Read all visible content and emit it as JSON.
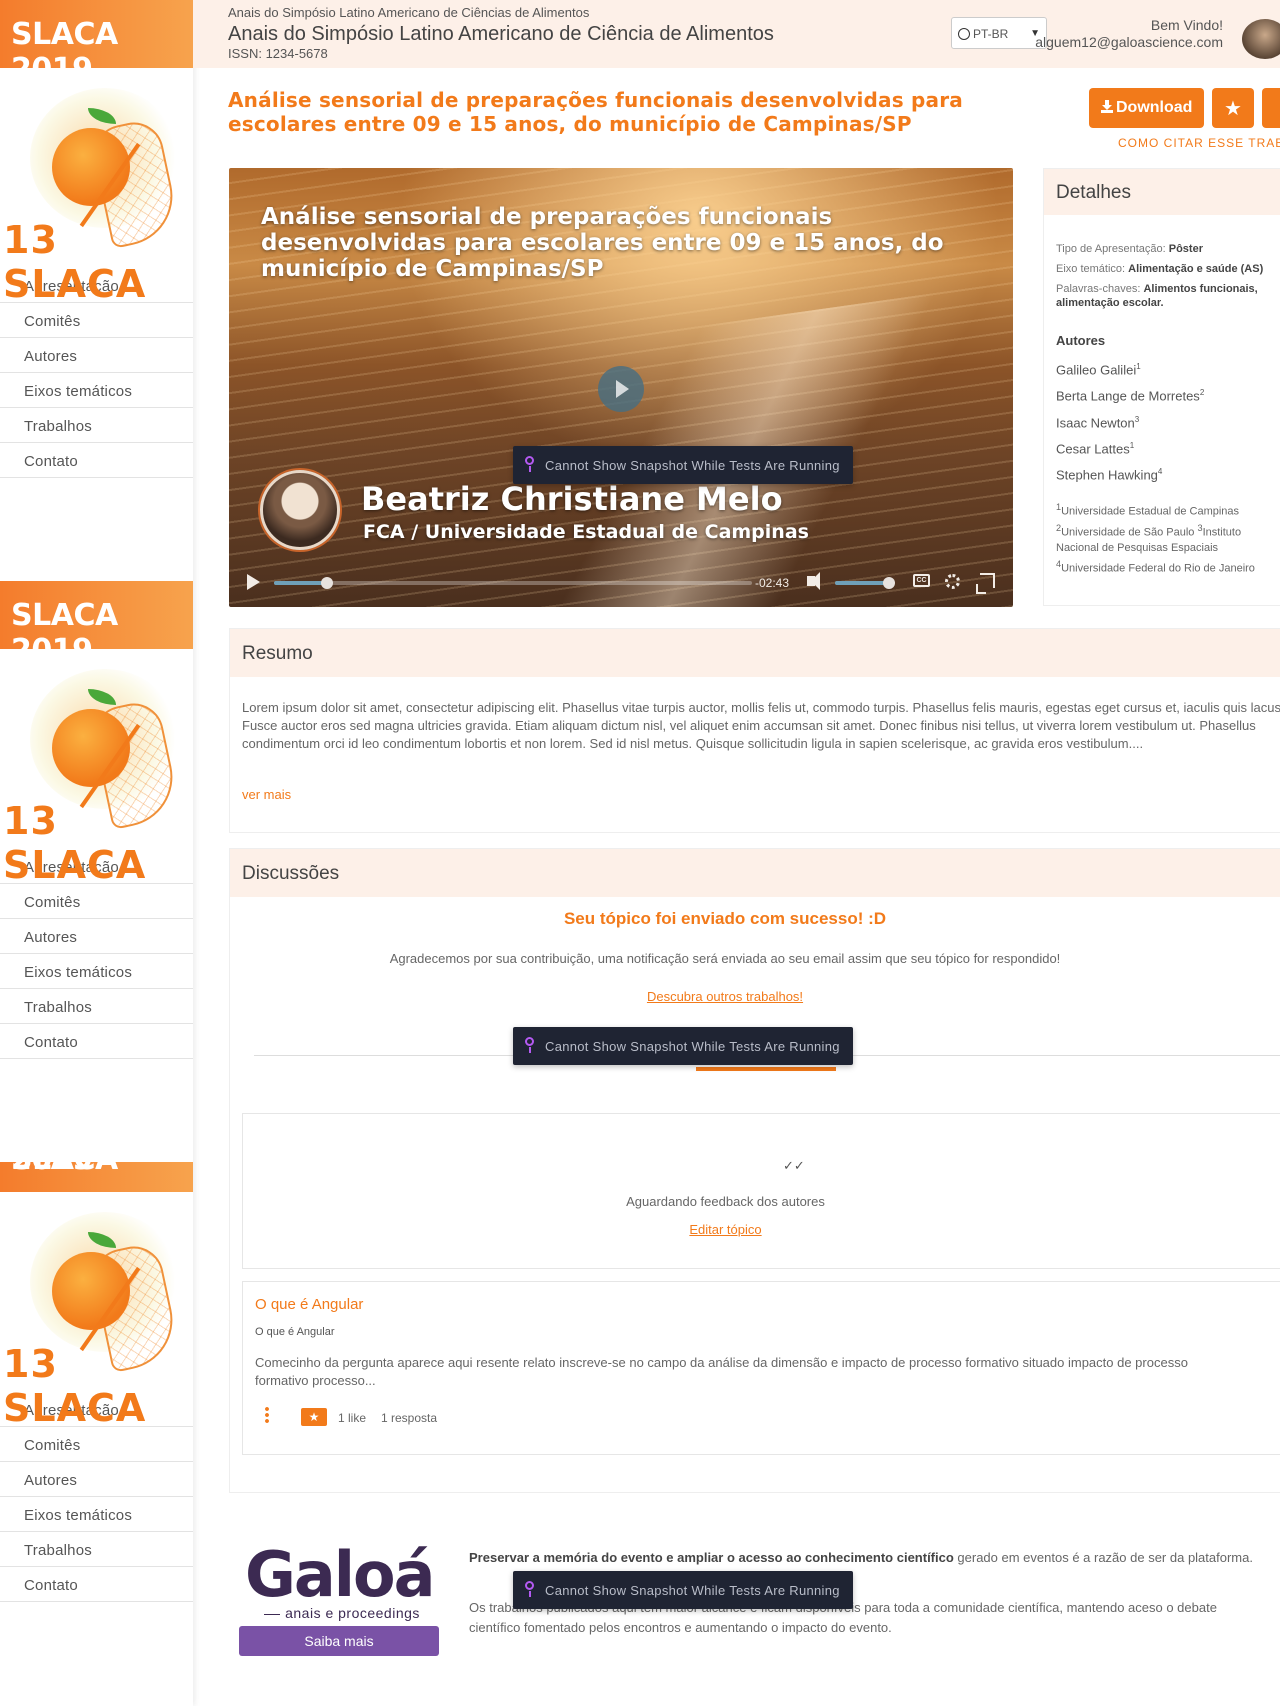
{
  "sidebar": {
    "event_label": "SLACA 2019",
    "logo_text": "13 SLACA",
    "items": [
      {
        "label": "Apresentação"
      },
      {
        "label": "Comitês"
      },
      {
        "label": "Autores"
      },
      {
        "label": "Eixos temáticos"
      },
      {
        "label": "Trabalhos"
      },
      {
        "label": "Contato"
      }
    ]
  },
  "header": {
    "small_title": "Anais do Simpósio Latino Americano de Ciências de Alimentos",
    "title": "Anais do Simpósio Latino Americano de Ciência de Alimentos",
    "issn": "ISSN: 1234-5678",
    "language": "PT-BR",
    "welcome": "Bem Vindo!",
    "email": "alguem12@galoascience.com"
  },
  "paper": {
    "title": "Análise sensorial de preparações funcionais desenvolvidas para escolares entre 09 e 15 anos, do município de Campinas/SP",
    "download_label": "Download",
    "cite_label": "COMO CITAR ESSE TRABALHO"
  },
  "video": {
    "title": "Análise sensorial de preparações funcionais desenvolvidas para escolares entre 09 e 15 anos, do município de Campinas/SP",
    "speaker": "Beatriz Christiane Melo",
    "affiliation": "FCA / Universidade Estadual de Campinas",
    "time_remaining": "-02:43",
    "progress": 0.11,
    "volume": 0.9,
    "cc_label": "CC"
  },
  "snapshot_notice": "Cannot Show Snapshot While Tests Are Running",
  "details": {
    "heading": "Detalhes",
    "presentation_type_label": "Tipo de Apresentação:",
    "presentation_type": "Pôster",
    "axis_label": "Eixo temático:",
    "axis": "Alimentação e saúde (AS)",
    "keywords_label": "Palavras-chaves:",
    "keywords": "Alimentos funcionais, alimentação escolar.",
    "authors_heading": "Autores",
    "authors": [
      {
        "name": "Galileo Galilei",
        "sup": "1"
      },
      {
        "name": "Berta Lange de Morretes",
        "sup": "2"
      },
      {
        "name": "Isaac Newton",
        "sup": "3"
      },
      {
        "name": "Cesar Lattes",
        "sup": "1"
      },
      {
        "name": "Stephen Hawking",
        "sup": "4"
      }
    ],
    "institutions": [
      {
        "sup": "1",
        "name": "Universidade Estadual de Campinas"
      },
      {
        "sup": "2",
        "name": "Universidade de São Paulo"
      },
      {
        "sup": "3",
        "name": "Instituto Nacional de Pesquisas Espaciais"
      },
      {
        "sup": "4",
        "name": "Universidade Federal do Rio de Janeiro"
      }
    ]
  },
  "resumo": {
    "heading": "Resumo",
    "text": "Lorem ipsum dolor sit amet, consectetur adipiscing elit. Phasellus vitae turpis auctor, mollis felis ut, commodo turpis. Phasellus felis mauris, egestas eget cursus et, iaculis quis lacus. Fusce auctor eros sed magna ultricies gravida. Etiam aliquam dictum nisl, vel aliquet enim accumsan sit amet. Donec finibus nisi tellus, ut viverra lorem vestibulum ut. Phasellus condimentum orci id leo condimentum lobortis et non lorem. Sed id nisl metus. Quisque sollicitudin ligula in sapien scelerisque, ac gravida eros vestibulum....",
    "more_label": "ver mais"
  },
  "discussoes": {
    "heading": "Discussões",
    "success": "Seu tópico foi enviado com sucesso! :D",
    "thanks": "Agradecemos por sua contribuição, uma notificação será enviada ao seu email assim que seu tópico for respondido!",
    "discover_link": "Descubra outros trabalhos!",
    "waiting": "Aguardando feedback dos autores",
    "edit_link": "Editar tópico",
    "topic": {
      "title": "O que é Angular",
      "subtitle": "O que é Angular",
      "body": "Comecinho da pergunta aparece aqui resente relato inscreve-se no campo da análise da dimensão e impacto de processo formativo situado impacto de processo formativo processo...",
      "likes": "1 like",
      "replies": "1 resposta"
    }
  },
  "footer": {
    "logo": "Galoá",
    "tagline": "anais e proceedings",
    "button": "Saiba mais",
    "p1_bold": "Preservar a memória do evento e ampliar o acesso ao conhecimento científico",
    "p1_rest": " gerado em eventos é a razão de ser da plataforma.",
    "p2": "Os trabalhos publicados aqui têm maior alcance e ficam disponíveis para toda a comunidade científica, mantendo aceso o debate científico fomentado pelos encontros e aumentando o impacto do evento."
  },
  "colors": {
    "accent": "#f27a1a",
    "header_bg": "#fdf0e8",
    "galoa_purple": "#3c2a52",
    "button_purple": "#7a52a6",
    "snapshot_bg": "#1f2433"
  }
}
